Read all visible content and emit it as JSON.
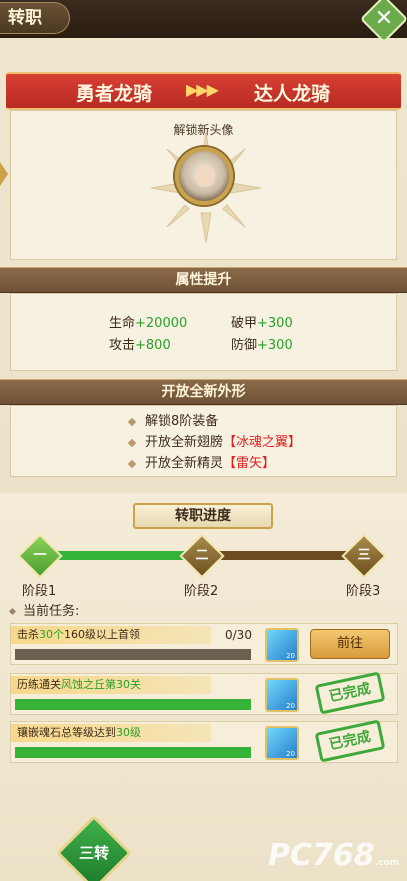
{
  "header": {
    "title": "转职"
  },
  "transfer": {
    "from_class": "勇者龙骑",
    "arrows": "▶▶▶",
    "to_class": "达人龙骑"
  },
  "unlock": {
    "title": "解锁新头像"
  },
  "attributes": {
    "title": "属性提升",
    "items": [
      {
        "name": "生命",
        "value": "+20000"
      },
      {
        "name": "破甲",
        "value": "+300"
      },
      {
        "name": "攻击",
        "value": "+800"
      },
      {
        "name": "防御",
        "value": "+300"
      }
    ]
  },
  "appearance": {
    "title": "开放全新外形",
    "items": [
      {
        "text": "解锁8阶装备",
        "highlight": ""
      },
      {
        "text": "开放全新翅膀",
        "highlight": "【冰魂之翼】"
      },
      {
        "text": "开放全新精灵",
        "highlight": "【雷矢】"
      }
    ]
  },
  "progress": {
    "title": "转职进度",
    "nodes": [
      "一",
      "二",
      "三"
    ],
    "stages": [
      "阶段1",
      "阶段2",
      "阶段3"
    ],
    "current_task_label": "当前任务:",
    "tasks": [
      {
        "pre": "击杀",
        "g1": "30个",
        "mid": "160级以上首领",
        "g2": "",
        "post": "",
        "count": "0/30",
        "progress": 0.0,
        "reward_count": "20",
        "action": "前往",
        "done": false
      },
      {
        "pre": "历练通关",
        "g1": "风蚀之丘第30关",
        "mid": "",
        "g2": "",
        "post": "",
        "count": "",
        "progress": 1.0,
        "reward_count": "20",
        "action": "",
        "done": true
      },
      {
        "pre": "镶嵌魂石总等级达到",
        "g1": "30级",
        "mid": "",
        "g2": "",
        "post": "",
        "count": "",
        "progress": 1.0,
        "reward_count": "20",
        "action": "",
        "done": true
      }
    ],
    "done_label": "已完成"
  },
  "bottom": {
    "badge": "三转"
  },
  "watermark": {
    "text": "PC768",
    "sub": ".com"
  },
  "colors": {
    "green": "#38b33a",
    "red": "#e02020",
    "ribbon": "#c8322a"
  }
}
